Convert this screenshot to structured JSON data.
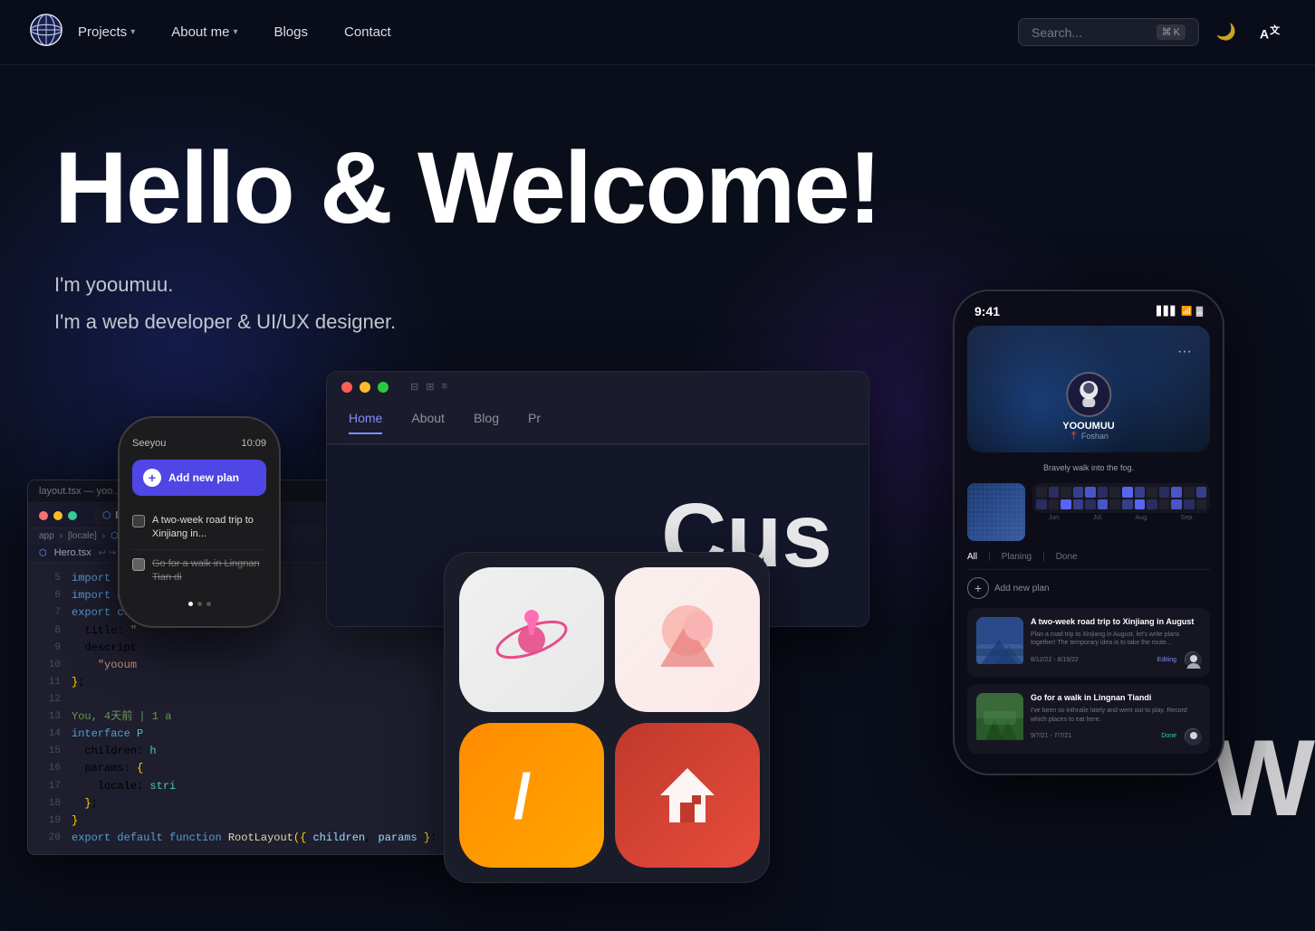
{
  "nav": {
    "logo_alt": "site logo",
    "links": [
      {
        "label": "Projects",
        "has_dropdown": true
      },
      {
        "label": "About me",
        "has_dropdown": true
      },
      {
        "label": "Blogs",
        "has_dropdown": false
      },
      {
        "label": "Contact",
        "has_dropdown": false
      }
    ],
    "search": {
      "placeholder": "Search...",
      "kbd_modifier": "⌘",
      "kbd_key": "K"
    },
    "dark_mode_icon": "🌙",
    "translate_icon": "A"
  },
  "hero": {
    "title": "Hello & Welcome!",
    "intro_name": "I'm yooumuu.",
    "intro_role": "I'm a web developer & UI/UX designer."
  },
  "code_editor": {
    "filename": "layout.tsx — yoo...",
    "tabs": [
      {
        "label": "layout.tsx",
        "active": true
      },
      {
        "label": "##",
        "active": false
      }
    ],
    "breadcrumb": "app > [locale] > ##",
    "hero_tab": "Hero.tsx",
    "lines": [
      {
        "num": 5,
        "content": "import { ... }",
        "type": "import"
      },
      {
        "num": 6,
        "content": "import Nav",
        "type": "import"
      },
      {
        "num": 7,
        "content": "export con"
      },
      {
        "num": 8,
        "content": "  title: \""
      },
      {
        "num": 9,
        "content": "  descript"
      },
      {
        "num": 10,
        "content": "    \"yooum"
      },
      {
        "num": 11,
        "content": "};"
      },
      {
        "num": 12,
        "content": ""
      },
      {
        "num": 13,
        "content": "You, 4天前 | 1 a"
      },
      {
        "num": 14,
        "content": "interface P"
      },
      {
        "num": 15,
        "content": "  children: h"
      },
      {
        "num": 16,
        "content": "  params: {"
      },
      {
        "num": 17,
        "content": "    locale: stri"
      },
      {
        "num": 18,
        "content": "  };"
      },
      {
        "num": 19,
        "content": "}"
      },
      {
        "num": 20,
        "content": "export default function RootLayout({ children, params }: Props)"
      }
    ]
  },
  "watch": {
    "notification_label": "Seeyou",
    "time": "10:09",
    "add_button_label": "Add new plan",
    "todos": [
      {
        "text": "A two-week road trip to Xinjiang in...",
        "done": false
      },
      {
        "text": "Go for a walk in Lingnan Tian di",
        "done": true
      }
    ],
    "dots": [
      true,
      false,
      false
    ]
  },
  "browser": {
    "nav_items": [
      "Home",
      "About",
      "Blog",
      "Pr"
    ],
    "active_nav": "Home",
    "hero_text": "Cus"
  },
  "apps_grid": {
    "icons": [
      {
        "id": "app1",
        "name": "Orbit App"
      },
      {
        "id": "app2",
        "name": "Gradient App"
      },
      {
        "id": "app3",
        "name": "Slash App"
      },
      {
        "id": "app4",
        "name": "Home App"
      }
    ]
  },
  "phone": {
    "time": "9:41",
    "username": "YOOUMUU",
    "location": "Foshan",
    "bio": "Bravely walk into the fog.",
    "tabs": [
      "All",
      "Planing",
      "Done"
    ],
    "active_tab": "All",
    "add_plan_label": "Add new plan",
    "posts": [
      {
        "title": "A two-week road trip to Xinjiang in August",
        "desc": "Plan a road trip to Xinjiang in August, let's write plans together! The temporary idea is to take the route...",
        "date": "8/12/22 - 8/19/22",
        "status": "Editing",
        "status_type": "editing"
      },
      {
        "title": "Go for a walk in Lingnan Tiandi",
        "desc": "I've been so inthralie lately and went out to play. Record which places to eat here.",
        "date": "9/7/21 - 7/7/21",
        "status": "Done",
        "status_type": "done"
      }
    ],
    "month_labels": [
      "Jun.",
      "Jul.",
      "Aug.",
      "Sep."
    ]
  },
  "colors": {
    "bg_primary": "#0a0e1a",
    "accent_blue": "#4f46e5",
    "accent_purple": "#818cf8",
    "nav_bg": "#0d0d1a"
  }
}
